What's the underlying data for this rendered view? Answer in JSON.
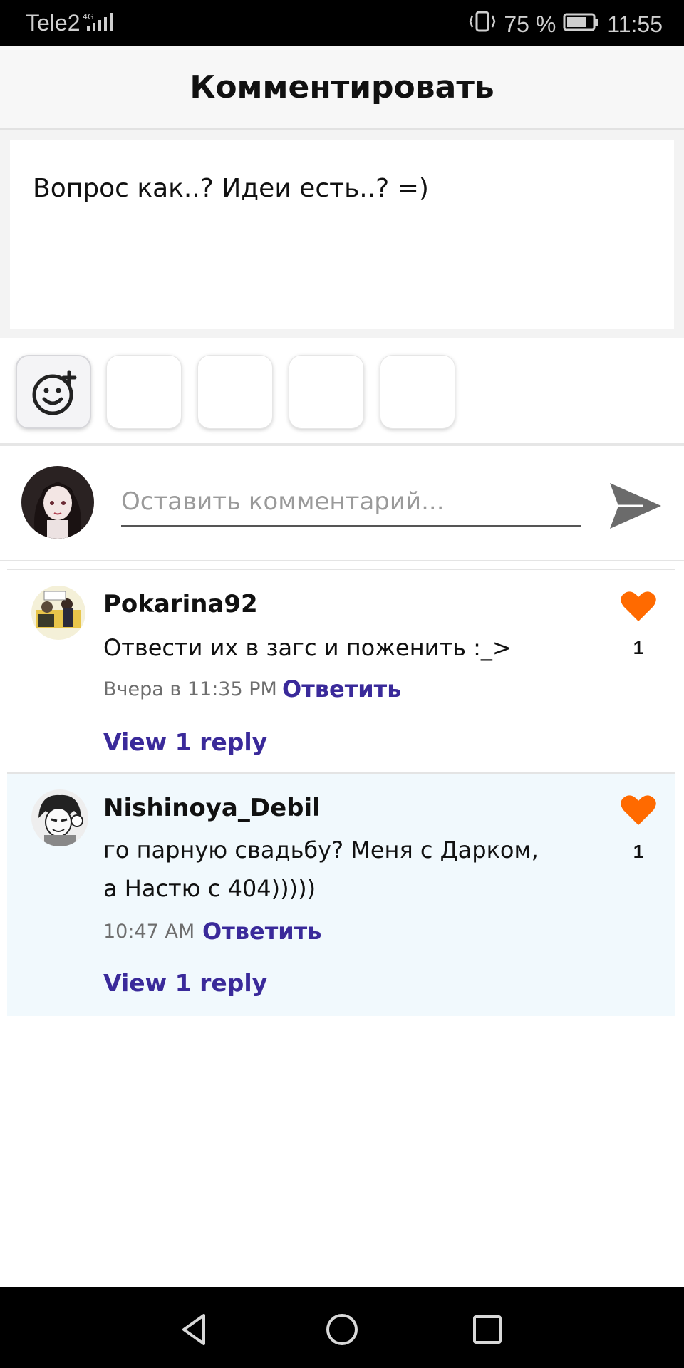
{
  "status": {
    "carrier": "Tele2",
    "network": "4G",
    "battery": "75 %",
    "time": "11:55"
  },
  "header": {
    "title": "Комментировать"
  },
  "composer": {
    "text": "Вопрос как..? Идеи есть..? =)"
  },
  "stickers": {
    "add_icon": "smiley-plus-icon",
    "slots": 4
  },
  "comment_input": {
    "placeholder": "Оставить комментарий...",
    "send_icon": "send-icon"
  },
  "comments": [
    {
      "user": "Pokarina92",
      "text": "Отвести их в загс и поженить :_>",
      "time": "Вчера в 11:35 PM",
      "reply": "Ответить",
      "view_replies": "View 1 reply",
      "likes": "1"
    },
    {
      "user": "Nishinoya_Debil",
      "text": "го парную свадьбу? Меня с Дарком, а Настю с 404)))))",
      "time": "10:47 AM",
      "reply": "Ответить",
      "view_replies": "View 1 reply",
      "likes": "1"
    }
  ],
  "colors": {
    "accent": "#3a2a9a",
    "heart": "#ff6a00",
    "highlight": "#f1f9fd"
  }
}
